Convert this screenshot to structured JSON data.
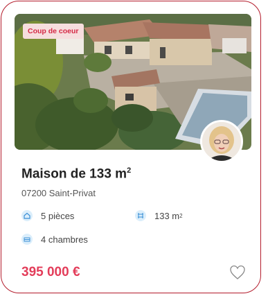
{
  "listing": {
    "badge": "Coup de coeur",
    "title": "Maison de 133 m",
    "title_sup": "2",
    "location": "07200 Saint-Privat",
    "features": {
      "rooms": "5 pièces",
      "area_prefix": "133 m",
      "area_sup": "2",
      "bedrooms": "4 chambres"
    },
    "price": "395 000 €",
    "icons": {
      "rooms": "home-icon",
      "area": "area-measure-icon",
      "bedrooms": "bed-icon",
      "favorite": "heart-icon"
    },
    "colors": {
      "card_border": "#b31b2b",
      "price": "#e33d5a",
      "badge_bg": "#f6dede",
      "badge_text": "#d52a46",
      "icon_bg": "#dbeefb",
      "icon_fg": "#3a8fd6"
    }
  }
}
